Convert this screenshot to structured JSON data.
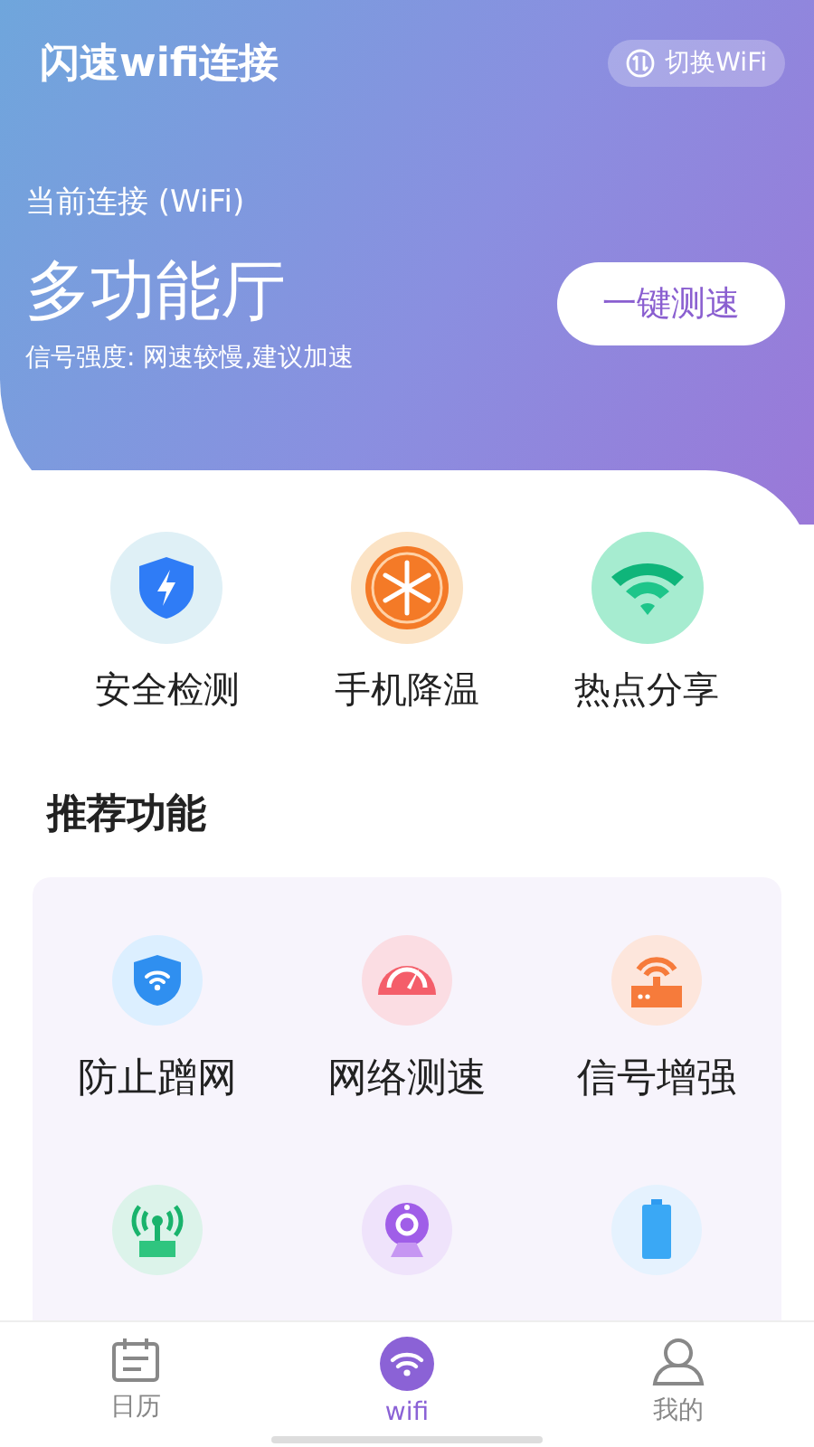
{
  "header": {
    "title": "闪速wifi连接",
    "switch_button": "切换WiFi"
  },
  "connection": {
    "caption": "当前连接 (WiFi)",
    "ssid": "多功能厅",
    "speed_button": "一键测速",
    "signal": "信号强度: 网速较慢,建议加速"
  },
  "quick_tools": [
    {
      "kind": "shield",
      "label": "安全检测"
    },
    {
      "kind": "snow",
      "label": "手机降温"
    },
    {
      "kind": "wifi",
      "label": "热点分享"
    }
  ],
  "section_title": "推荐功能",
  "features": [
    {
      "kind": "shield-wifi",
      "label": "防止蹭网"
    },
    {
      "kind": "gauge",
      "label": "网络测速"
    },
    {
      "kind": "router",
      "label": "信号增强"
    },
    {
      "kind": "antenna"
    },
    {
      "kind": "camera"
    },
    {
      "kind": "battery"
    }
  ],
  "tabs": [
    {
      "kind": "calendar",
      "label": "日历",
      "selected": false
    },
    {
      "kind": "wifi",
      "label": "wifi",
      "selected": true
    },
    {
      "kind": "user",
      "label": "我的",
      "selected": false
    }
  ]
}
